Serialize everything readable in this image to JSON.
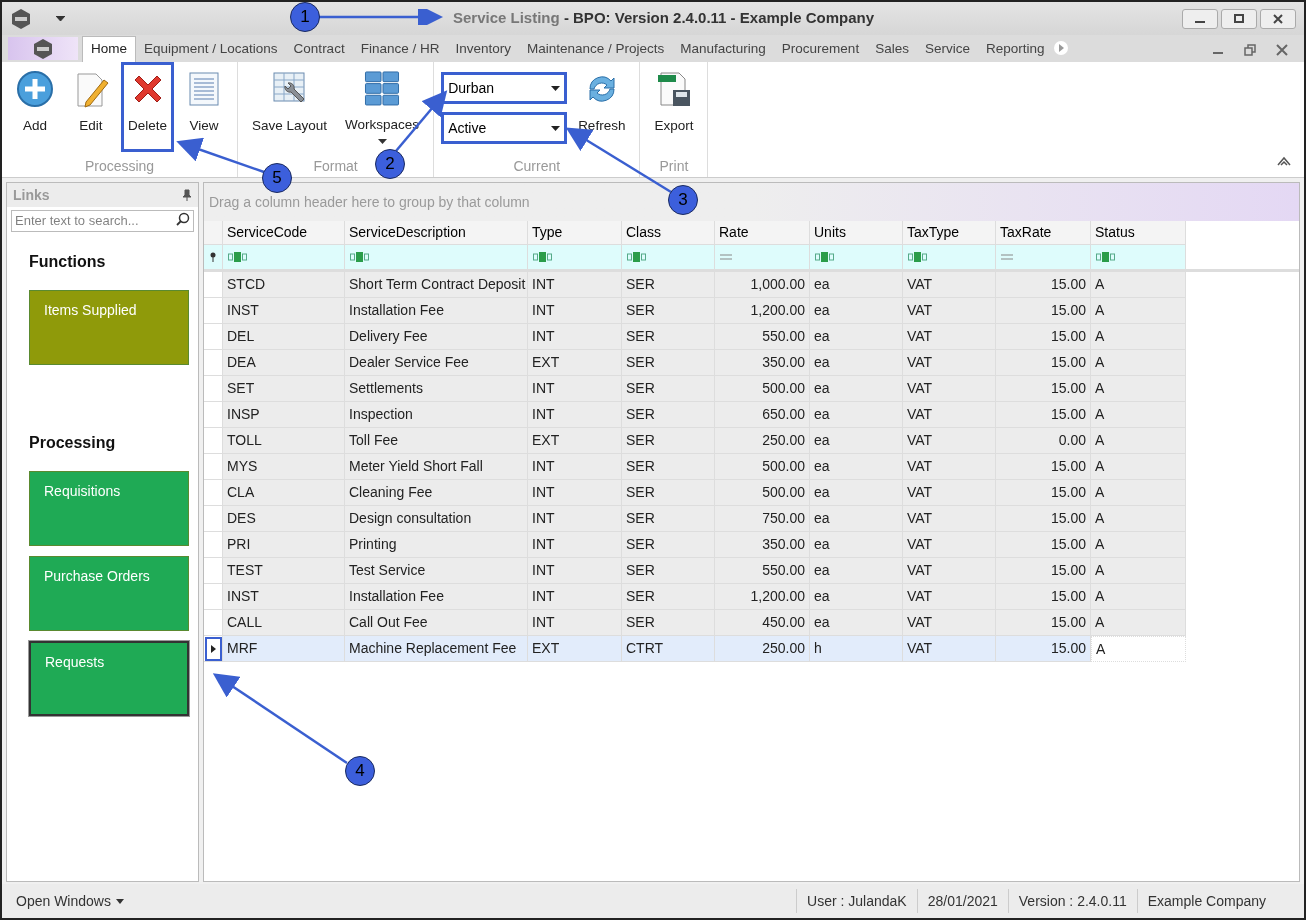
{
  "window": {
    "title_document": "Service Listing",
    "title_app": "- BPO: Version 2.4.0.11 - Example Company"
  },
  "menu_tabs": [
    {
      "label": "Home",
      "selected": true
    },
    {
      "label": "Equipment / Locations",
      "selected": false
    },
    {
      "label": "Contract",
      "selected": false
    },
    {
      "label": "Finance / HR",
      "selected": false
    },
    {
      "label": "Inventory",
      "selected": false
    },
    {
      "label": "Maintenance / Projects",
      "selected": false
    },
    {
      "label": "Manufacturing",
      "selected": false
    },
    {
      "label": "Procurement",
      "selected": false
    },
    {
      "label": "Sales",
      "selected": false
    },
    {
      "label": "Service",
      "selected": false
    },
    {
      "label": "Reporting",
      "selected": false
    }
  ],
  "ribbon_groups": [
    {
      "label": "Processing",
      "items": [
        {
          "kind": "add",
          "label": "Add",
          "highlighted": false
        },
        {
          "kind": "edit",
          "label": "Edit",
          "highlighted": false
        },
        {
          "kind": "delete",
          "label": "Delete",
          "highlighted": true
        },
        {
          "kind": "view",
          "label": "View",
          "highlighted": false
        }
      ]
    },
    {
      "label": "Format",
      "items": [
        {
          "kind": "layout",
          "label": "Save Layout",
          "highlighted": false
        },
        {
          "kind": "workspaces",
          "label": "Workspaces",
          "highlighted": false
        }
      ]
    },
    {
      "label": "Current",
      "items": [
        {
          "kind": "dropdowns",
          "values": [
            "Durban",
            "Active"
          ],
          "highlighted": true
        },
        {
          "kind": "refresh",
          "label": "Refresh",
          "highlighted": false
        }
      ]
    },
    {
      "label": "Print",
      "items": [
        {
          "kind": "export",
          "label": "Export",
          "highlighted": false
        }
      ]
    }
  ],
  "links_panel": {
    "title": "Links",
    "search_placeholder": "Enter text to search...",
    "sections": [
      {
        "heading": "Functions",
        "tiles": [
          {
            "label": "Items Supplied",
            "color": "#8f9a0a",
            "focused": false
          }
        ]
      },
      {
        "heading": "Processing",
        "tiles": [
          {
            "label": "Requisitions",
            "color": "#1faa55",
            "focused": false
          },
          {
            "label": "Purchase Orders",
            "color": "#1faa55",
            "focused": false
          },
          {
            "label": "Requests",
            "color": "#1faa55",
            "focused": true
          }
        ]
      }
    ]
  },
  "grid": {
    "group_hint": "Drag a column header here to group by that column",
    "columns": [
      {
        "label": "ServiceCode",
        "numeric": false
      },
      {
        "label": "ServiceDescription",
        "numeric": false
      },
      {
        "label": "Type",
        "numeric": false
      },
      {
        "label": "Class",
        "numeric": false
      },
      {
        "label": "Rate",
        "numeric": true
      },
      {
        "label": "Units",
        "numeric": false
      },
      {
        "label": "TaxType",
        "numeric": false
      },
      {
        "label": "TaxRate",
        "numeric": true
      },
      {
        "label": "Status",
        "numeric": false
      }
    ],
    "rows": [
      {
        "selected": false,
        "cells": [
          "STCD",
          "Short Term Contract Deposit",
          "INT",
          "SER",
          "1,000.00",
          "ea",
          "VAT",
          "15.00",
          "A"
        ]
      },
      {
        "selected": false,
        "cells": [
          "INST",
          "Installation Fee",
          "INT",
          "SER",
          "1,200.00",
          "ea",
          "VAT",
          "15.00",
          "A"
        ]
      },
      {
        "selected": false,
        "cells": [
          "DEL",
          "Delivery Fee",
          "INT",
          "SER",
          "550.00",
          "ea",
          "VAT",
          "15.00",
          "A"
        ]
      },
      {
        "selected": false,
        "cells": [
          "DEA",
          "Dealer Service Fee",
          "EXT",
          "SER",
          "350.00",
          "ea",
          "VAT",
          "15.00",
          "A"
        ]
      },
      {
        "selected": false,
        "cells": [
          "SET",
          "Settlements",
          "INT",
          "SER",
          "500.00",
          "ea",
          "VAT",
          "15.00",
          "A"
        ]
      },
      {
        "selected": false,
        "cells": [
          "INSP",
          "Inspection",
          "INT",
          "SER",
          "650.00",
          "ea",
          "VAT",
          "15.00",
          "A"
        ]
      },
      {
        "selected": false,
        "cells": [
          "TOLL",
          "Toll Fee",
          "EXT",
          "SER",
          "250.00",
          "ea",
          "VAT",
          "0.00",
          "A"
        ]
      },
      {
        "selected": false,
        "cells": [
          "MYS",
          "Meter Yield Short Fall",
          "INT",
          "SER",
          "500.00",
          "ea",
          "VAT",
          "15.00",
          "A"
        ]
      },
      {
        "selected": false,
        "cells": [
          "CLA",
          "Cleaning Fee",
          "INT",
          "SER",
          "500.00",
          "ea",
          "VAT",
          "15.00",
          "A"
        ]
      },
      {
        "selected": false,
        "cells": [
          "DES",
          "Design consultation",
          "INT",
          "SER",
          "750.00",
          "ea",
          "VAT",
          "15.00",
          "A"
        ]
      },
      {
        "selected": false,
        "cells": [
          "PRI",
          "Printing",
          "INT",
          "SER",
          "350.00",
          "ea",
          "VAT",
          "15.00",
          "A"
        ]
      },
      {
        "selected": false,
        "cells": [
          "TEST",
          "Test Service",
          "INT",
          "SER",
          "550.00",
          "ea",
          "VAT",
          "15.00",
          "A"
        ]
      },
      {
        "selected": false,
        "cells": [
          "INST",
          "Installation Fee",
          "INT",
          "SER",
          "1,200.00",
          "ea",
          "VAT",
          "15.00",
          "A"
        ]
      },
      {
        "selected": false,
        "cells": [
          "CALL",
          "Call Out Fee",
          "INT",
          "SER",
          "450.00",
          "ea",
          "VAT",
          "15.00",
          "A"
        ]
      },
      {
        "selected": true,
        "cells": [
          "MRF",
          "Machine Replacement Fee",
          "EXT",
          "CTRT",
          "250.00",
          "h",
          "VAT",
          "15.00",
          "A"
        ]
      }
    ]
  },
  "status_bar": {
    "open_windows": "Open Windows",
    "items": [
      "User : JulandaK",
      "28/01/2021",
      "Version : 2.4.0.11",
      "Example Company"
    ]
  },
  "callouts": [
    "1",
    "2",
    "3",
    "4",
    "5"
  ]
}
